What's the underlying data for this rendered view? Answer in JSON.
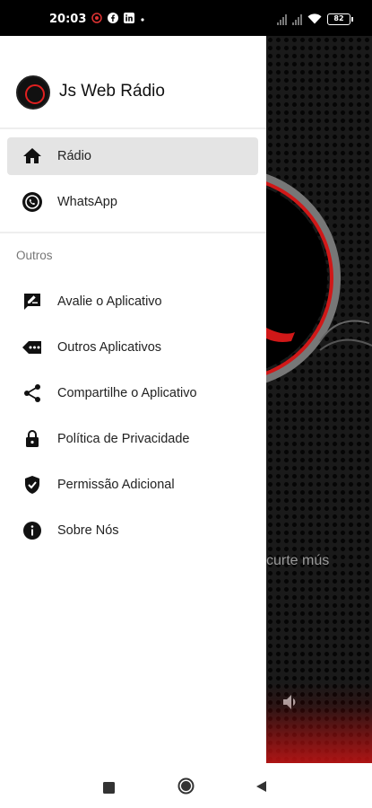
{
  "status_bar": {
    "time": "20:03",
    "battery": "82"
  },
  "drawer": {
    "app_title": "Js Web Rádio",
    "primary_items": [
      {
        "label": "Rádio",
        "icon": "home-icon",
        "active": true
      },
      {
        "label": "WhatsApp",
        "icon": "whatsapp-icon",
        "active": false
      }
    ],
    "section_title": "Outros",
    "other_items": [
      {
        "label": "Avalie o Aplicativo",
        "icon": "rate-review-icon"
      },
      {
        "label": "Outros Aplicativos",
        "icon": "more-apps-icon"
      },
      {
        "label": "Compartilhe o Aplicativo",
        "icon": "share-icon"
      },
      {
        "label": "Política de Privacidade",
        "icon": "lock-icon"
      },
      {
        "label": "Permissão Adicional",
        "icon": "shield-check-icon"
      },
      {
        "label": "Sobre Nós",
        "icon": "info-icon"
      }
    ]
  },
  "background_app": {
    "visible_text": "curte mús",
    "accent_color": "#d01818"
  },
  "nav_bar": {
    "buttons": [
      "recent-apps",
      "home",
      "back"
    ]
  }
}
